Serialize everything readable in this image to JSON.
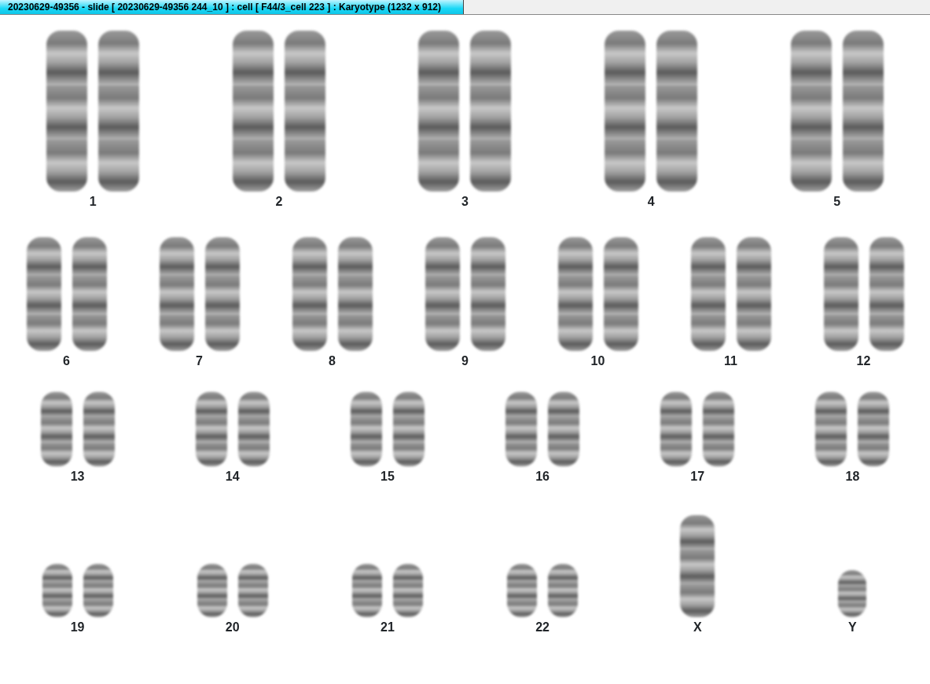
{
  "window": {
    "title": "20230629-49356 - slide [ 20230629-49356 244_10 ] : cell [ F44/3_cell 223 ] : Karyotype  (1232 x 912)"
  },
  "rows": [
    {
      "groups": [
        {
          "label": "1",
          "kind": "pair"
        },
        {
          "label": "2",
          "kind": "pair"
        },
        {
          "label": "3",
          "kind": "pair"
        },
        {
          "label": "4",
          "kind": "pair"
        },
        {
          "label": "5",
          "kind": "pair"
        }
      ]
    },
    {
      "groups": [
        {
          "label": "6",
          "kind": "pair"
        },
        {
          "label": "7",
          "kind": "pair"
        },
        {
          "label": "8",
          "kind": "pair"
        },
        {
          "label": "9",
          "kind": "pair"
        },
        {
          "label": "10",
          "kind": "pair"
        },
        {
          "label": "11",
          "kind": "pair"
        },
        {
          "label": "12",
          "kind": "pair"
        }
      ]
    },
    {
      "groups": [
        {
          "label": "13",
          "kind": "pair"
        },
        {
          "label": "14",
          "kind": "pair"
        },
        {
          "label": "15",
          "kind": "pair"
        },
        {
          "label": "16",
          "kind": "pair"
        },
        {
          "label": "17",
          "kind": "pair"
        },
        {
          "label": "18",
          "kind": "pair"
        }
      ]
    },
    {
      "groups": [
        {
          "label": "19",
          "kind": "pair"
        },
        {
          "label": "20",
          "kind": "pair"
        },
        {
          "label": "21",
          "kind": "pair"
        },
        {
          "label": "22",
          "kind": "pair"
        },
        {
          "label": "X",
          "kind": "single_long"
        },
        {
          "label": "Y",
          "kind": "single_short"
        }
      ]
    }
  ]
}
